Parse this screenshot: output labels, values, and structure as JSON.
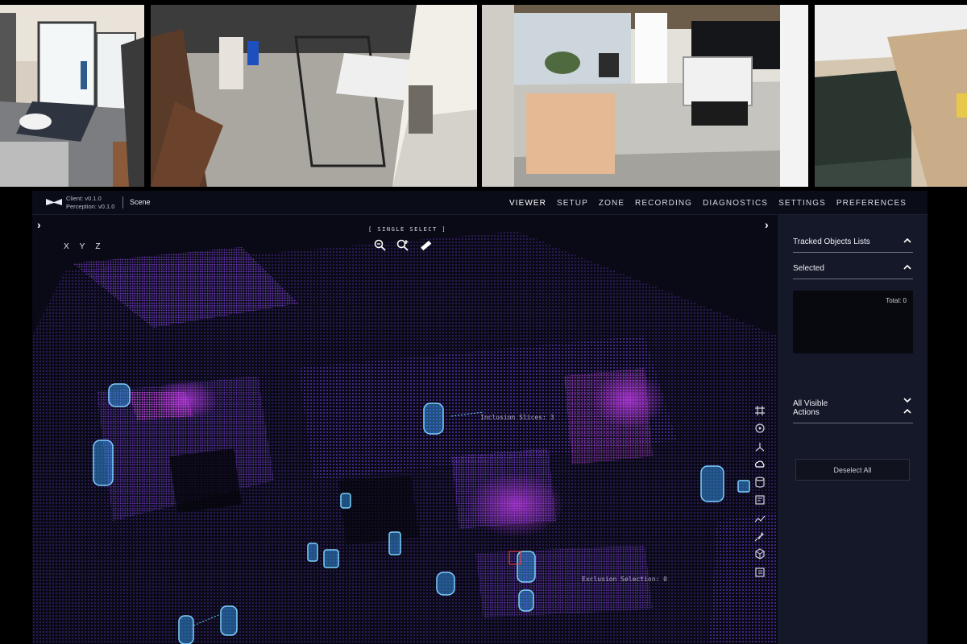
{
  "app": {
    "client_version": "Client: v0.1.0",
    "perception_version": "Perception: v0.1.0",
    "scene_label": "Scene"
  },
  "nav": [
    "VIEWER",
    "SETUP",
    "ZONE",
    "RECORDING",
    "DIAGNOSTICS",
    "SETTINGS",
    "PREFERENCES"
  ],
  "viewport": {
    "axes": [
      "X",
      "Y",
      "Z"
    ],
    "mode_label": "[ SINGLE SELECT ]",
    "tools": [
      "zoom-select-icon",
      "add-select-icon",
      "ruler-icon"
    ],
    "side_tools": [
      "grid-icon",
      "target-icon",
      "axis-icon",
      "cloud-icon",
      "database-icon",
      "note-icon",
      "chart-icon",
      "pin-icon",
      "cube-icon",
      "layers-icon"
    ],
    "labels": {
      "inclusion": "Inclusion Slices: 3",
      "exclusion": "Exclusion Selection: 0"
    }
  },
  "panel": {
    "tracked_title": "Tracked Objects Lists",
    "selected_title": "Selected",
    "total_label": "Total: 0",
    "all_visible_title": "All Visible",
    "actions_title": "Actions",
    "deselect_label": "Deselect All"
  },
  "colors": {
    "accent_purple": "#7a3cf0",
    "magenta": "#d23cf0",
    "track_blue": "#37a8ff",
    "panel_bg": "#151828"
  }
}
